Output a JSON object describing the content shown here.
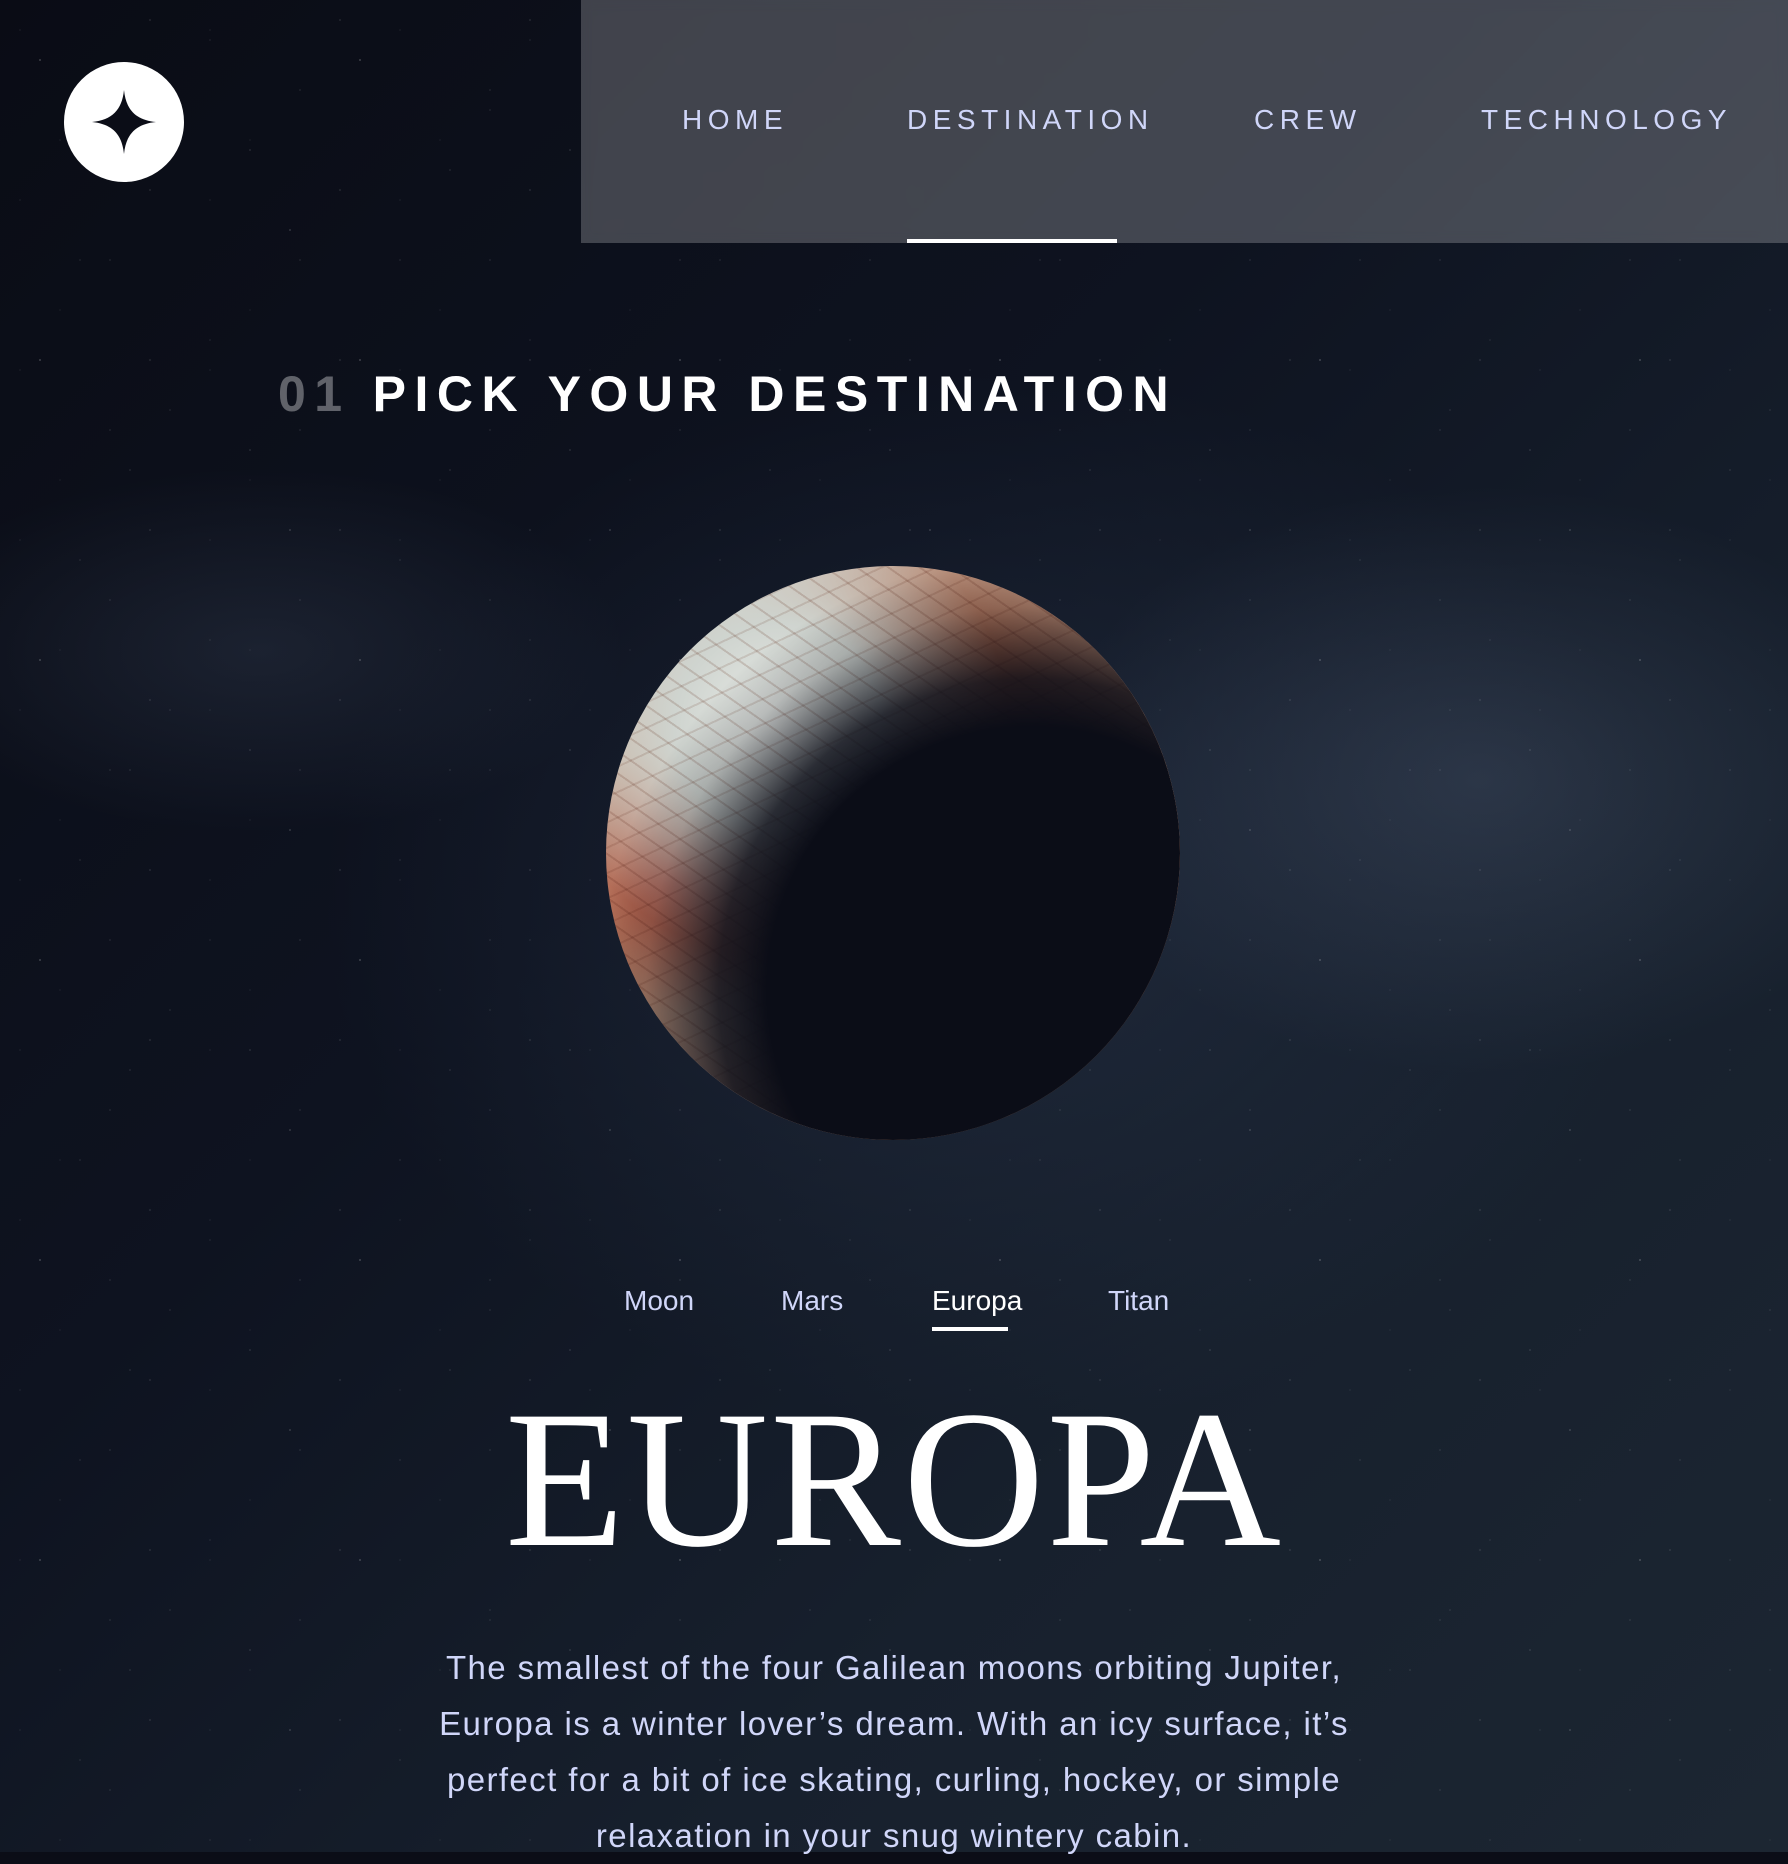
{
  "header": {
    "logo_icon": "star-logo-icon",
    "nav": [
      {
        "label": "HOME",
        "active": false
      },
      {
        "label": "DESTINATION",
        "active": true
      },
      {
        "label": "CREW",
        "active": false
      },
      {
        "label": "TECHNOLOGY",
        "active": false
      }
    ]
  },
  "section": {
    "number": "01",
    "title": "PICK YOUR DESTINATION"
  },
  "destination": {
    "image_icon": "europa-planet-image",
    "tabs": [
      {
        "label": "Moon",
        "active": false
      },
      {
        "label": "Mars",
        "active": false
      },
      {
        "label": "Europa",
        "active": true
      },
      {
        "label": "Titan",
        "active": false
      }
    ],
    "name": "EUROPA",
    "description": "The smallest of the four Galilean moons orbiting Jupiter, Europa is a winter lover’s dream. With an icy surface, it’s perfect for a bit of ice skating, curling, hockey, or simple relaxation in your snug wintery cabin."
  },
  "colors": {
    "background": "#0b0d17",
    "accent_text": "#d0d6f9",
    "white": "#ffffff"
  }
}
